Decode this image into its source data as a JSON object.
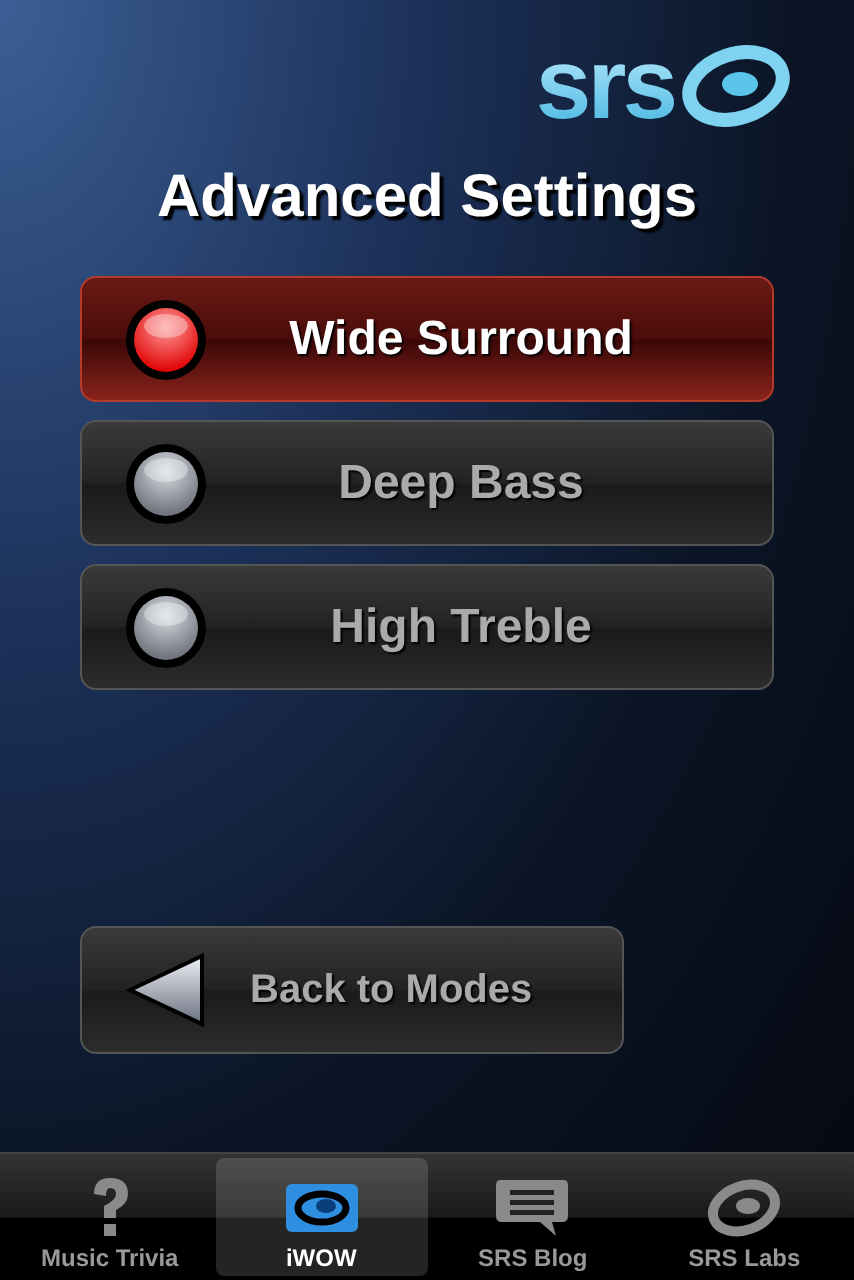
{
  "logo": {
    "text": "srs"
  },
  "title": "Advanced Settings",
  "settings": [
    {
      "label": "Wide Surround",
      "on": true
    },
    {
      "label": "Deep Bass",
      "on": false
    },
    {
      "label": "High Treble",
      "on": false
    }
  ],
  "back_button": {
    "label": "Back to Modes"
  },
  "tab_bar": [
    {
      "label": "Music Trivia",
      "kind": "question",
      "selected": false
    },
    {
      "label": "iWOW",
      "kind": "iwow",
      "selected": true
    },
    {
      "label": "SRS Blog",
      "kind": "blog",
      "selected": false
    },
    {
      "label": "SRS Labs",
      "kind": "labs",
      "selected": false
    }
  ]
}
